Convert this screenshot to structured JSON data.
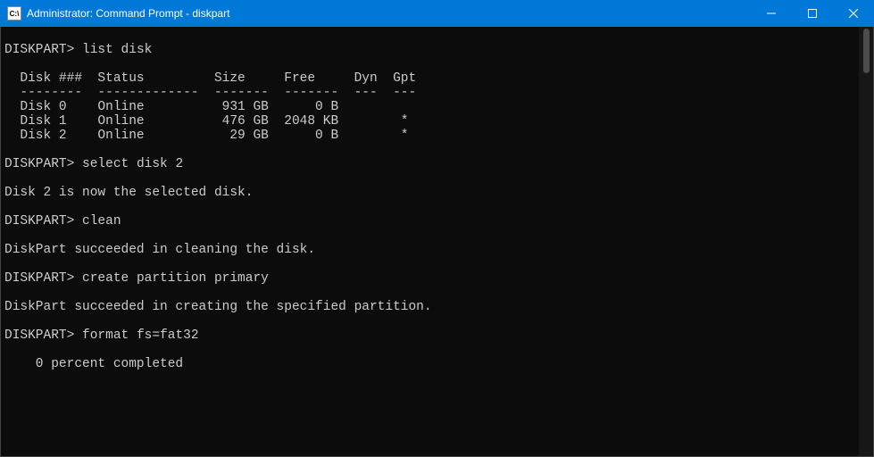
{
  "titlebar": {
    "icon_label": "C:\\",
    "title": "Administrator: Command Prompt - diskpart"
  },
  "terminal": {
    "prompt": "DISKPART>",
    "cmd_list_disk": "list disk",
    "table_header": "  Disk ###  Status         Size     Free     Dyn  Gpt",
    "table_divider": "  --------  -------------  -------  -------  ---  ---",
    "disk_rows": [
      "  Disk 0    Online          931 GB      0 B",
      "  Disk 1    Online          476 GB  2048 KB        *",
      "  Disk 2    Online           29 GB      0 B        *"
    ],
    "cmd_select_disk": "select disk 2",
    "msg_selected": "Disk 2 is now the selected disk.",
    "cmd_clean": "clean",
    "msg_clean_ok": "DiskPart succeeded in cleaning the disk.",
    "cmd_create_partition": "create partition primary",
    "msg_partition_ok": "DiskPart succeeded in creating the specified partition.",
    "cmd_format": "format fs=fat32",
    "msg_progress": "    0 percent completed"
  }
}
